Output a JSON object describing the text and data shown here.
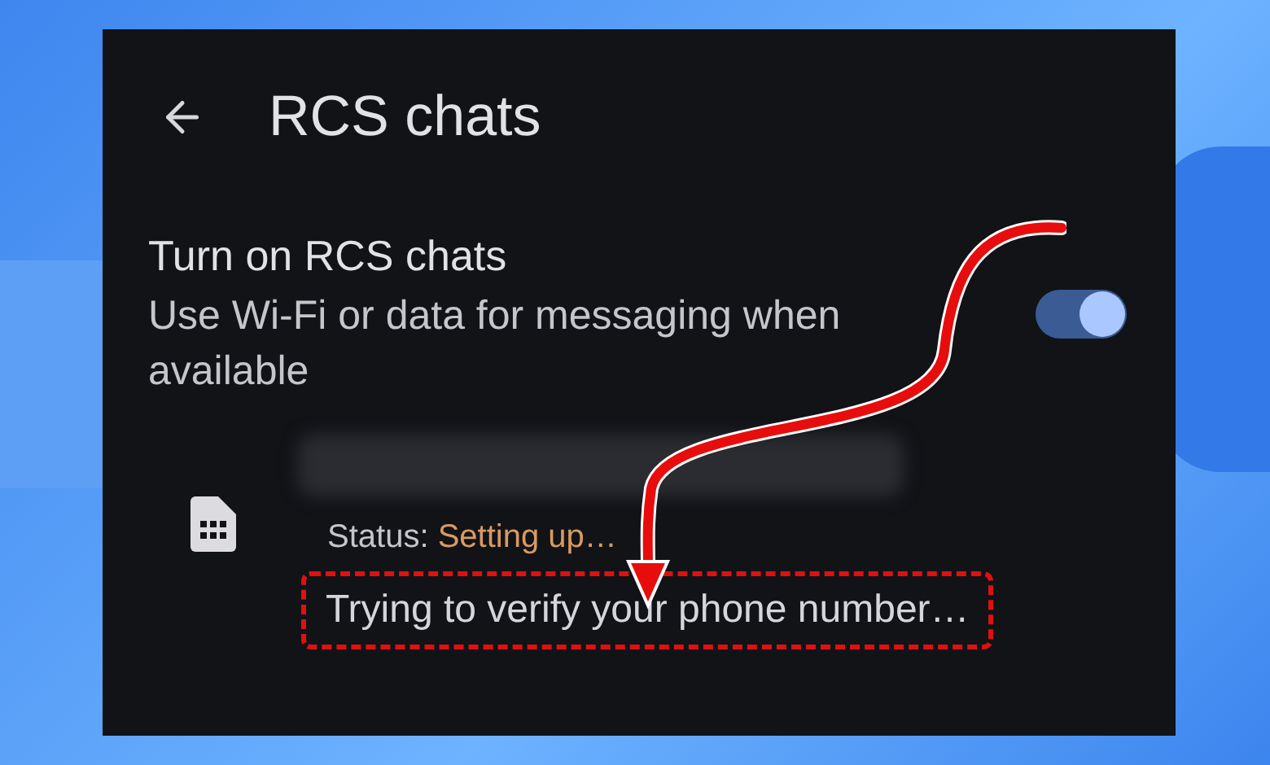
{
  "header": {
    "title": "RCS chats"
  },
  "setting": {
    "title": "Turn on RCS chats",
    "description": "Use Wi-Fi or data for messaging when available",
    "on": true
  },
  "sim": {
    "status_label": "Status:",
    "status_value": "Setting up…",
    "message": "Trying to verify your phone number…"
  }
}
